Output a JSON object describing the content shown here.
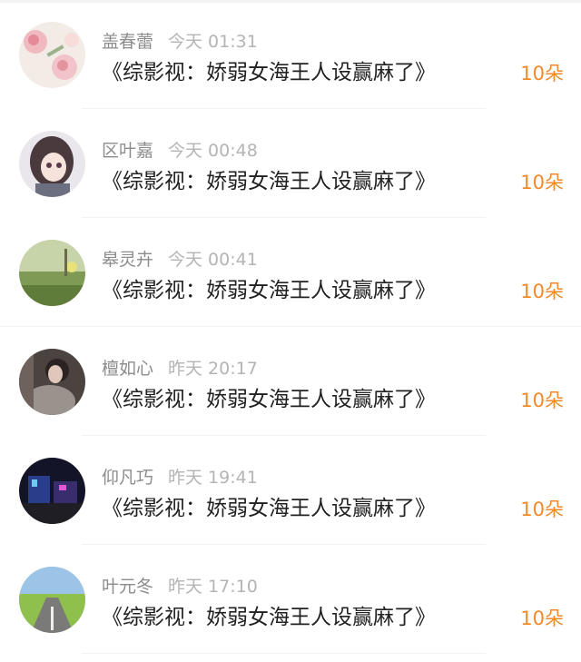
{
  "rows": [
    {
      "name": "盖春蕾",
      "time": "今天 01:31",
      "message": "《综影视：娇弱女海王人设赢麻了》",
      "amount": "10朵",
      "avatar_icon": "pink-flowers-icon"
    },
    {
      "name": "区叶嘉",
      "time": "今天 00:48",
      "message": "《综影视：娇弱女海王人设赢麻了》",
      "amount": "10朵",
      "avatar_icon": "anime-girl-icon"
    },
    {
      "name": "皋灵卉",
      "time": "今天 00:41",
      "message": "《综影视：娇弱女海王人设赢麻了》",
      "amount": "10朵",
      "avatar_icon": "green-grass-icon"
    },
    {
      "name": "檀如心",
      "time": "昨天 20:17",
      "message": "《综影视：娇弱女海王人设赢麻了》",
      "amount": "10朵",
      "avatar_icon": "person-photo-icon"
    },
    {
      "name": "仰凡巧",
      "time": "昨天 19:41",
      "message": "《综影视：娇弱女海王人设赢麻了》",
      "amount": "10朵",
      "avatar_icon": "night-street-icon"
    },
    {
      "name": "叶元冬",
      "time": "昨天 17:10",
      "message": "《综影视：娇弱女海王人设赢麻了》",
      "amount": "10朵",
      "avatar_icon": "road-landscape-icon"
    }
  ],
  "colors": {
    "name": "#8c8c8c",
    "time": "#b4b4b4",
    "message": "#222222",
    "amount": "#f08a2e"
  }
}
